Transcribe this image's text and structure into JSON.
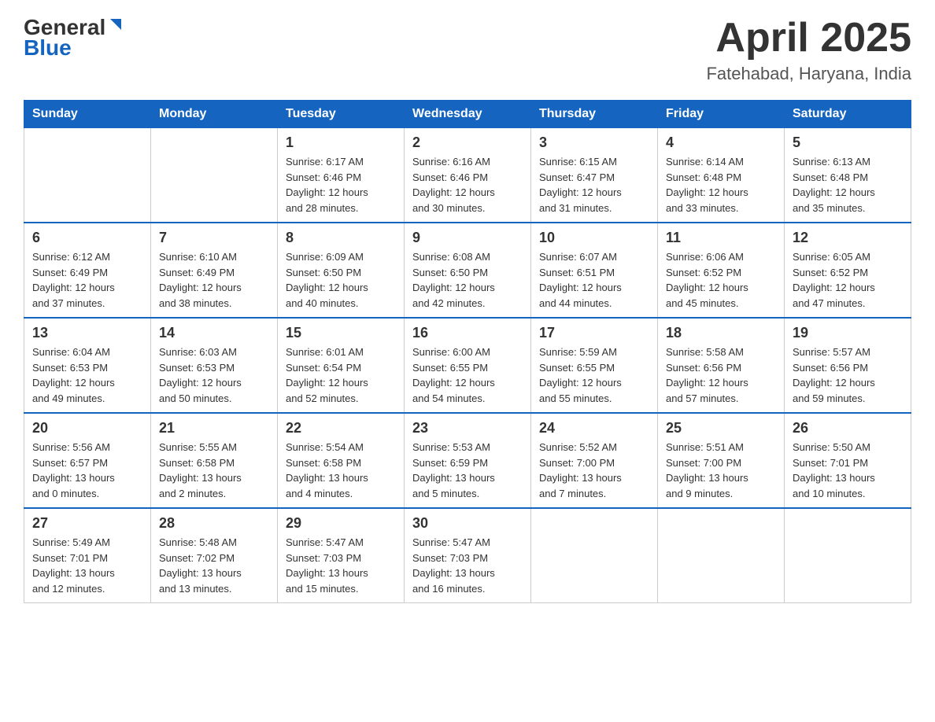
{
  "header": {
    "logo_general": "General",
    "logo_blue": "Blue",
    "month": "April 2025",
    "location": "Fatehabad, Haryana, India"
  },
  "days_of_week": [
    "Sunday",
    "Monday",
    "Tuesday",
    "Wednesday",
    "Thursday",
    "Friday",
    "Saturday"
  ],
  "weeks": [
    [
      {
        "day": "",
        "info": ""
      },
      {
        "day": "",
        "info": ""
      },
      {
        "day": "1",
        "info": "Sunrise: 6:17 AM\nSunset: 6:46 PM\nDaylight: 12 hours\nand 28 minutes."
      },
      {
        "day": "2",
        "info": "Sunrise: 6:16 AM\nSunset: 6:46 PM\nDaylight: 12 hours\nand 30 minutes."
      },
      {
        "day": "3",
        "info": "Sunrise: 6:15 AM\nSunset: 6:47 PM\nDaylight: 12 hours\nand 31 minutes."
      },
      {
        "day": "4",
        "info": "Sunrise: 6:14 AM\nSunset: 6:48 PM\nDaylight: 12 hours\nand 33 minutes."
      },
      {
        "day": "5",
        "info": "Sunrise: 6:13 AM\nSunset: 6:48 PM\nDaylight: 12 hours\nand 35 minutes."
      }
    ],
    [
      {
        "day": "6",
        "info": "Sunrise: 6:12 AM\nSunset: 6:49 PM\nDaylight: 12 hours\nand 37 minutes."
      },
      {
        "day": "7",
        "info": "Sunrise: 6:10 AM\nSunset: 6:49 PM\nDaylight: 12 hours\nand 38 minutes."
      },
      {
        "day": "8",
        "info": "Sunrise: 6:09 AM\nSunset: 6:50 PM\nDaylight: 12 hours\nand 40 minutes."
      },
      {
        "day": "9",
        "info": "Sunrise: 6:08 AM\nSunset: 6:50 PM\nDaylight: 12 hours\nand 42 minutes."
      },
      {
        "day": "10",
        "info": "Sunrise: 6:07 AM\nSunset: 6:51 PM\nDaylight: 12 hours\nand 44 minutes."
      },
      {
        "day": "11",
        "info": "Sunrise: 6:06 AM\nSunset: 6:52 PM\nDaylight: 12 hours\nand 45 minutes."
      },
      {
        "day": "12",
        "info": "Sunrise: 6:05 AM\nSunset: 6:52 PM\nDaylight: 12 hours\nand 47 minutes."
      }
    ],
    [
      {
        "day": "13",
        "info": "Sunrise: 6:04 AM\nSunset: 6:53 PM\nDaylight: 12 hours\nand 49 minutes."
      },
      {
        "day": "14",
        "info": "Sunrise: 6:03 AM\nSunset: 6:53 PM\nDaylight: 12 hours\nand 50 minutes."
      },
      {
        "day": "15",
        "info": "Sunrise: 6:01 AM\nSunset: 6:54 PM\nDaylight: 12 hours\nand 52 minutes."
      },
      {
        "day": "16",
        "info": "Sunrise: 6:00 AM\nSunset: 6:55 PM\nDaylight: 12 hours\nand 54 minutes."
      },
      {
        "day": "17",
        "info": "Sunrise: 5:59 AM\nSunset: 6:55 PM\nDaylight: 12 hours\nand 55 minutes."
      },
      {
        "day": "18",
        "info": "Sunrise: 5:58 AM\nSunset: 6:56 PM\nDaylight: 12 hours\nand 57 minutes."
      },
      {
        "day": "19",
        "info": "Sunrise: 5:57 AM\nSunset: 6:56 PM\nDaylight: 12 hours\nand 59 minutes."
      }
    ],
    [
      {
        "day": "20",
        "info": "Sunrise: 5:56 AM\nSunset: 6:57 PM\nDaylight: 13 hours\nand 0 minutes."
      },
      {
        "day": "21",
        "info": "Sunrise: 5:55 AM\nSunset: 6:58 PM\nDaylight: 13 hours\nand 2 minutes."
      },
      {
        "day": "22",
        "info": "Sunrise: 5:54 AM\nSunset: 6:58 PM\nDaylight: 13 hours\nand 4 minutes."
      },
      {
        "day": "23",
        "info": "Sunrise: 5:53 AM\nSunset: 6:59 PM\nDaylight: 13 hours\nand 5 minutes."
      },
      {
        "day": "24",
        "info": "Sunrise: 5:52 AM\nSunset: 7:00 PM\nDaylight: 13 hours\nand 7 minutes."
      },
      {
        "day": "25",
        "info": "Sunrise: 5:51 AM\nSunset: 7:00 PM\nDaylight: 13 hours\nand 9 minutes."
      },
      {
        "day": "26",
        "info": "Sunrise: 5:50 AM\nSunset: 7:01 PM\nDaylight: 13 hours\nand 10 minutes."
      }
    ],
    [
      {
        "day": "27",
        "info": "Sunrise: 5:49 AM\nSunset: 7:01 PM\nDaylight: 13 hours\nand 12 minutes."
      },
      {
        "day": "28",
        "info": "Sunrise: 5:48 AM\nSunset: 7:02 PM\nDaylight: 13 hours\nand 13 minutes."
      },
      {
        "day": "29",
        "info": "Sunrise: 5:47 AM\nSunset: 7:03 PM\nDaylight: 13 hours\nand 15 minutes."
      },
      {
        "day": "30",
        "info": "Sunrise: 5:47 AM\nSunset: 7:03 PM\nDaylight: 13 hours\nand 16 minutes."
      },
      {
        "day": "",
        "info": ""
      },
      {
        "day": "",
        "info": ""
      },
      {
        "day": "",
        "info": ""
      }
    ]
  ]
}
